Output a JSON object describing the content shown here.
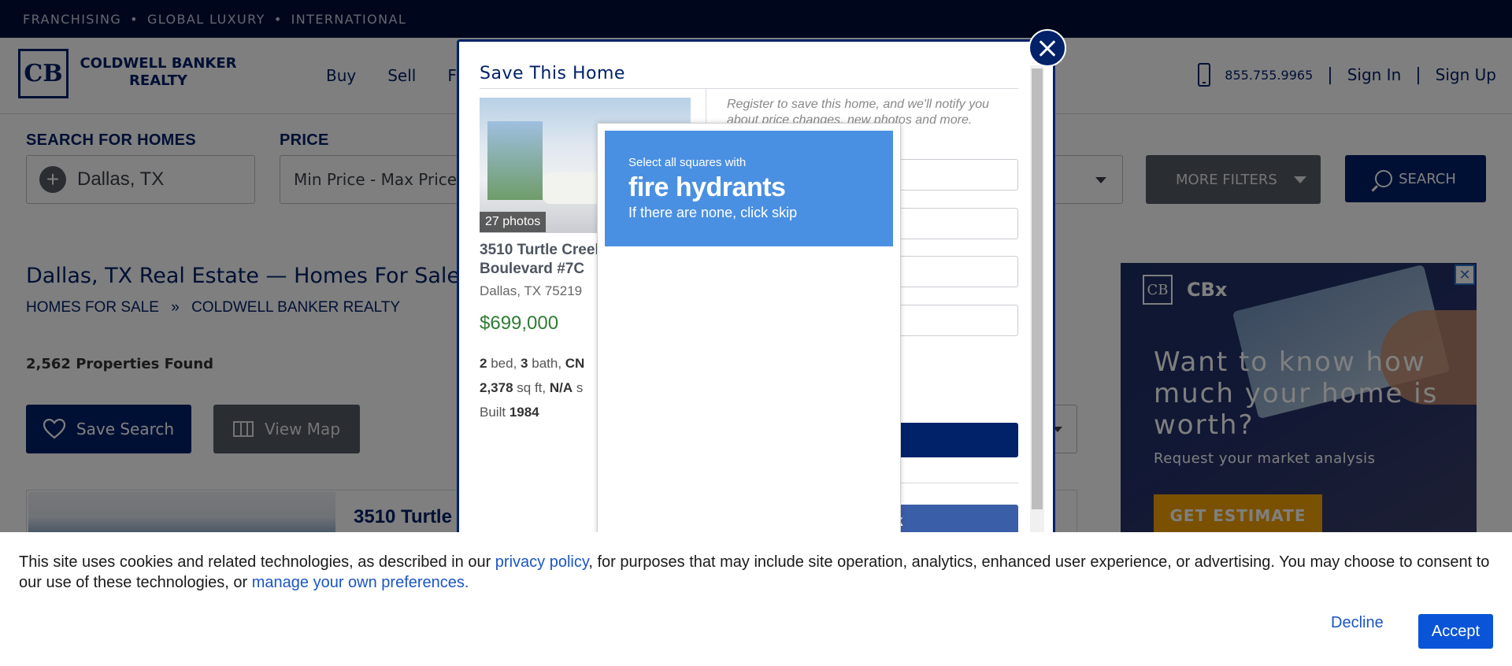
{
  "top_strip": {
    "items": [
      "FRANCHISING",
      "GLOBAL LUXURY",
      "INTERNATIONAL"
    ],
    "separator": "•"
  },
  "header": {
    "logo_mark": "CB",
    "logo_line1": "COLDWELL BANKER",
    "logo_line2": "REALTY",
    "nav": [
      "Buy",
      "Sell",
      "F"
    ],
    "phone": "855.755.9965",
    "separator": "|",
    "sign_in": "Sign In",
    "sign_up": "Sign Up"
  },
  "search": {
    "location_label": "SEARCH FOR HOMES",
    "location_value": "Dallas, TX",
    "price_label": "PRICE",
    "price_value": "Min Price  -  Max Price",
    "more_filters": "MORE FILTERS",
    "search_button": "SEARCH"
  },
  "page": {
    "title": "Dallas, TX Real Estate — Homes For Sale",
    "breadcrumb": [
      "HOMES FOR SALE",
      "COLDWELL BANKER REALTY"
    ],
    "breadcrumb_sep": "»",
    "property_count": "2,562 Properties Found",
    "save_search": "Save Search",
    "view_map": "View Map",
    "listing_title": "3510 Turtle"
  },
  "ad": {
    "logo_mark": "CB",
    "brand": "CBx",
    "close": "✕",
    "headline": "Want to know how much your home is worth?",
    "subtext": "Request your market analysis",
    "cta": "GET ESTIMATE"
  },
  "modal": {
    "title": "Save This Home",
    "photo_count": "27 photos",
    "address": "3510 Turtle Creek Boulevard #7C",
    "city": "Dallas, TX 75219",
    "price": "$699,000",
    "beds": "2",
    "beds_label": "bed,",
    "baths": "3",
    "baths_label": "bath,",
    "cn": "CN",
    "sqft": "2,378",
    "sqft_label": "sq ft,",
    "lot": "N/A",
    "lot_label": "s",
    "built_label": "Built",
    "built": "1984",
    "register_text": "Register to save this home, and we'll notify you about price changes, new photos and more.",
    "email_placeholder_fragment": "m",
    "create_fragment": "e",
    "divider_fragment": "orm",
    "facebook_fragment": "acebook"
  },
  "captcha": {
    "line1": "Select all squares with",
    "line2": "fire hydrants",
    "line3": "If there are none, click skip"
  },
  "cookie": {
    "text_1": "This site uses cookies and related technologies, as described in our ",
    "privacy_link": "privacy policy",
    "text_2": ", for purposes that may include site operation, analytics, enhanced user experience, or advertising. You may choose to consent to our use of these technologies, or ",
    "preferences_link": "manage your own preferences",
    "text_3": ".",
    "decline": "Decline",
    "accept": "Accept"
  },
  "colors": {
    "brand_navy": "#012169",
    "cookie_accept": "#0a54d8",
    "captcha_blue": "#4a90e2",
    "ad_cta": "#f5a200"
  }
}
